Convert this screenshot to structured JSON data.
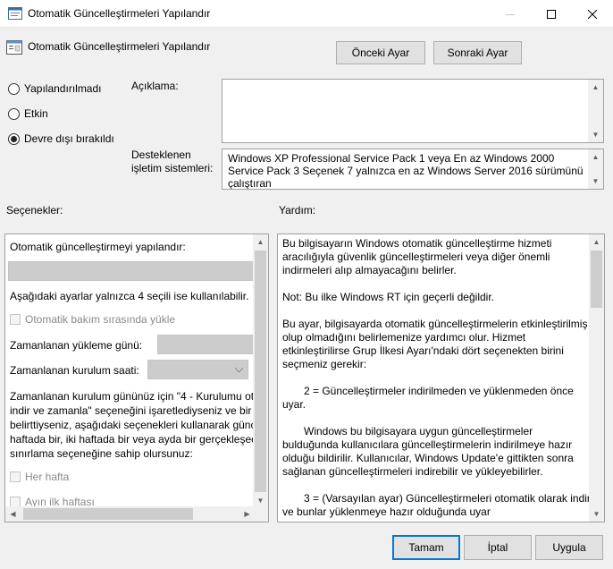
{
  "window": {
    "title": "Otomatik Güncelleştirmeleri Yapılandır",
    "header_title": "Otomatik Güncelleştirmeleri Yapılandır"
  },
  "nav": {
    "prev_label": "Önceki Ayar",
    "next_label": "Sonraki Ayar"
  },
  "state": {
    "options": [
      {
        "label": "Yapılandırılmadı",
        "selected": false
      },
      {
        "label": "Etkin",
        "selected": false
      },
      {
        "label": "Devre dışı bırakıldı",
        "selected": true
      }
    ]
  },
  "description": {
    "label": "Açıklama:",
    "value": ""
  },
  "supported": {
    "label_line1": "Desteklenen",
    "label_line2": "işletim sistemleri:",
    "text": "Windows XP Professional Service Pack 1 veya En az Windows 2000 Service Pack 3 Seçenek 7 yalnızca en az Windows Server 2016 sürümünü çalıştıran"
  },
  "options_panel": {
    "label": "Seçenekler:",
    "configure_label": "Otomatik güncelleştirmeyi yapılandır:",
    "note": "Aşağıdaki ayarlar yalnızca 4 seçili ise kullanılabilir.",
    "maintenance_label": "Otomatik bakım sırasında yükle",
    "install_day_label": "Zamanlanan yükleme günü:",
    "install_time_label": "Zamanlanan kurulum saati:",
    "para_line1": "Zamanlanan kurulum gününüz için \"4 - Kurulumu ot",
    "para_line2": "indir ve zamanla\" seçeneğini işaretlediyseniz ve bir z",
    "para_line3": "belirttiyseniz, aşağıdaki seçenekleri kullanarak günce",
    "para_line4": "haftada bir, iki haftada bir veya ayda bir gerçekleşec",
    "para_line5": "sınırlama seçeneğine sahip olursunuz:",
    "every_week_label": "Her hafta",
    "first_week_label": "Ayın ilk haftası"
  },
  "help_panel": {
    "label": "Yardım:",
    "p1": "Bu bilgisayarın Windows otomatik güncelleştirme hizmeti aracılığıyla güvenlik güncelleştirmeleri veya diğer önemli indirmeleri alıp almayacağını belirler.",
    "p2": "Not: Bu ilke Windows RT için geçerli değildir.",
    "p3": "Bu ayar, bilgisayarda otomatik güncelleştirmelerin etkinleştirilmiş olup olmadığını belirlemenize yardımcı olur. Hizmet etkinleştirilirse Grup İlkesi Ayarı'ndaki dört seçenekten birini seçmeniz gerekir:",
    "p4": "2 = Güncelleştirmeler indirilmeden ve yüklenmeden önce uyar.",
    "p5": "Windows bu bilgisayara uygun güncelleştirmeler bulduğunda kullanıcılara güncelleştirmelerin indirilmeye hazır olduğu bildirilir. Kullanıcılar, Windows Update'e gittikten sonra sağlanan güncelleştirmeleri indirebilir ve yükleyebilirler.",
    "p6": "3 = (Varsayılan ayar) Güncelleştirmeleri otomatik olarak indir ve bunlar yüklenmeye hazır olduğunda uyar"
  },
  "footer": {
    "ok_label": "Tamam",
    "cancel_label": "İptal",
    "apply_label": "Uygula"
  }
}
